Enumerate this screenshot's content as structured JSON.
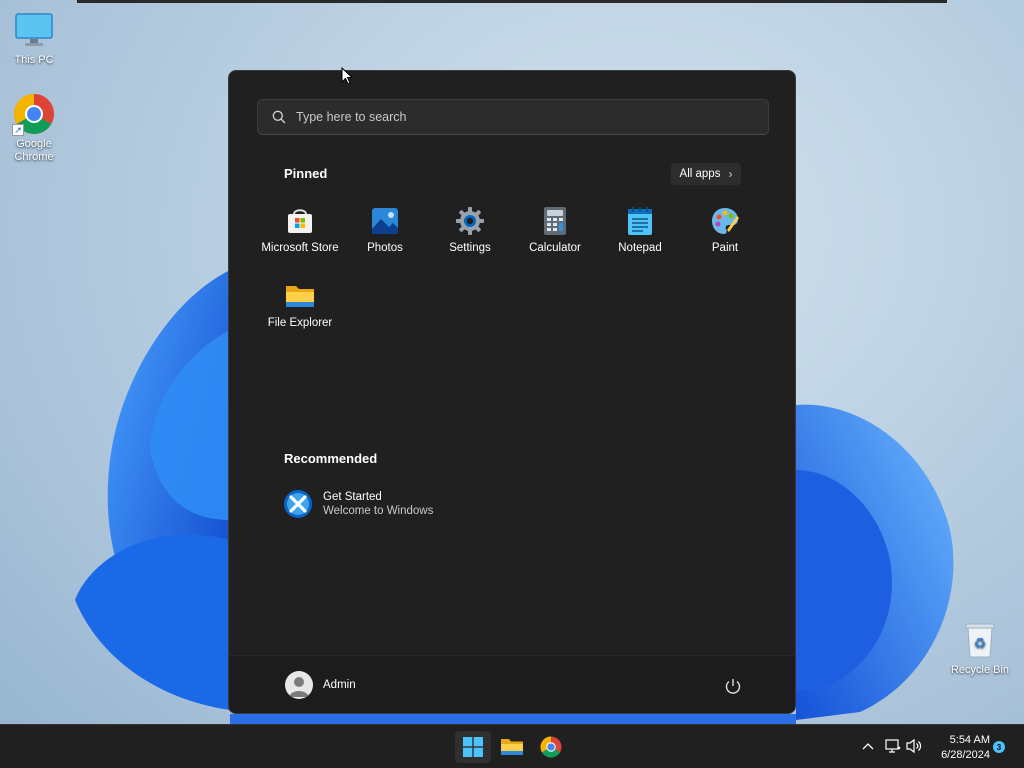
{
  "desktop": {
    "icons": [
      {
        "label": "This PC",
        "icon": "monitor-icon"
      },
      {
        "label": "Google Chrome",
        "icon": "chrome-icon"
      },
      {
        "label": "Recycle Bin",
        "icon": "recycle-bin-icon"
      }
    ]
  },
  "start_menu": {
    "search_placeholder": "Type here to search",
    "pinned_title": "Pinned",
    "all_apps_label": "All apps",
    "pinned_apps": [
      {
        "label": "Microsoft Store",
        "icon": "store-icon"
      },
      {
        "label": "Photos",
        "icon": "photos-icon"
      },
      {
        "label": "Settings",
        "icon": "settings-gear-icon"
      },
      {
        "label": "Calculator",
        "icon": "calculator-icon"
      },
      {
        "label": "Notepad",
        "icon": "notepad-icon"
      },
      {
        "label": "Paint",
        "icon": "paint-palette-icon"
      },
      {
        "label": "File Explorer",
        "icon": "folder-icon"
      }
    ],
    "recommended_title": "Recommended",
    "recommended": [
      {
        "title": "Get Started",
        "subtitle": "Welcome to Windows",
        "icon": "get-started-icon"
      }
    ],
    "user_name": "Admin"
  },
  "taskbar": {
    "apps": [
      "windows-start-icon",
      "file-explorer-icon",
      "chrome-icon"
    ],
    "time": "5:54 AM",
    "date": "6/28/2024",
    "notification_count": "3"
  },
  "colors": {
    "accent": "#0078d4",
    "start_bg": "#202020",
    "taskbar_bg": "#202020",
    "notif_badge": "#4cc2ff"
  }
}
